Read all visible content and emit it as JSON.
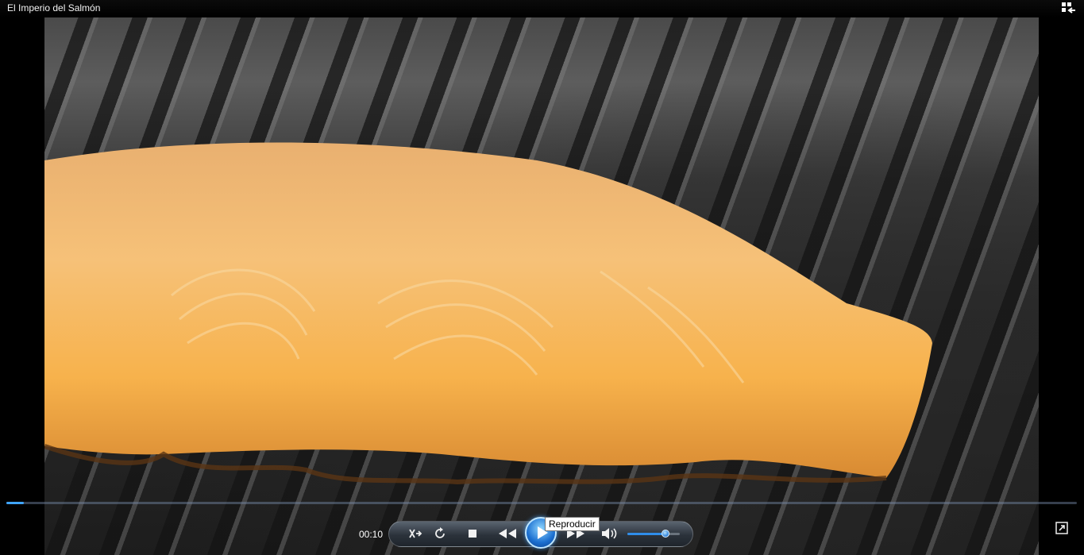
{
  "window": {
    "title": "El Imperio del Salmón"
  },
  "player": {
    "current_time": "00:10",
    "seek_progress": 0.016,
    "volume_level": 0.72,
    "play_tooltip": "Reproducir"
  },
  "icons": {
    "switch_library": "switch-to-library-icon",
    "shuffle": "shuffle-icon",
    "repeat": "repeat-icon",
    "stop": "stop-icon",
    "previous": "previous-icon",
    "play": "play-icon",
    "next": "next-icon",
    "volume": "speaker-icon",
    "fullscreen": "fullscreen-icon"
  },
  "colors": {
    "accent": "#3fa4ff",
    "salmon": "#f3b35a"
  }
}
